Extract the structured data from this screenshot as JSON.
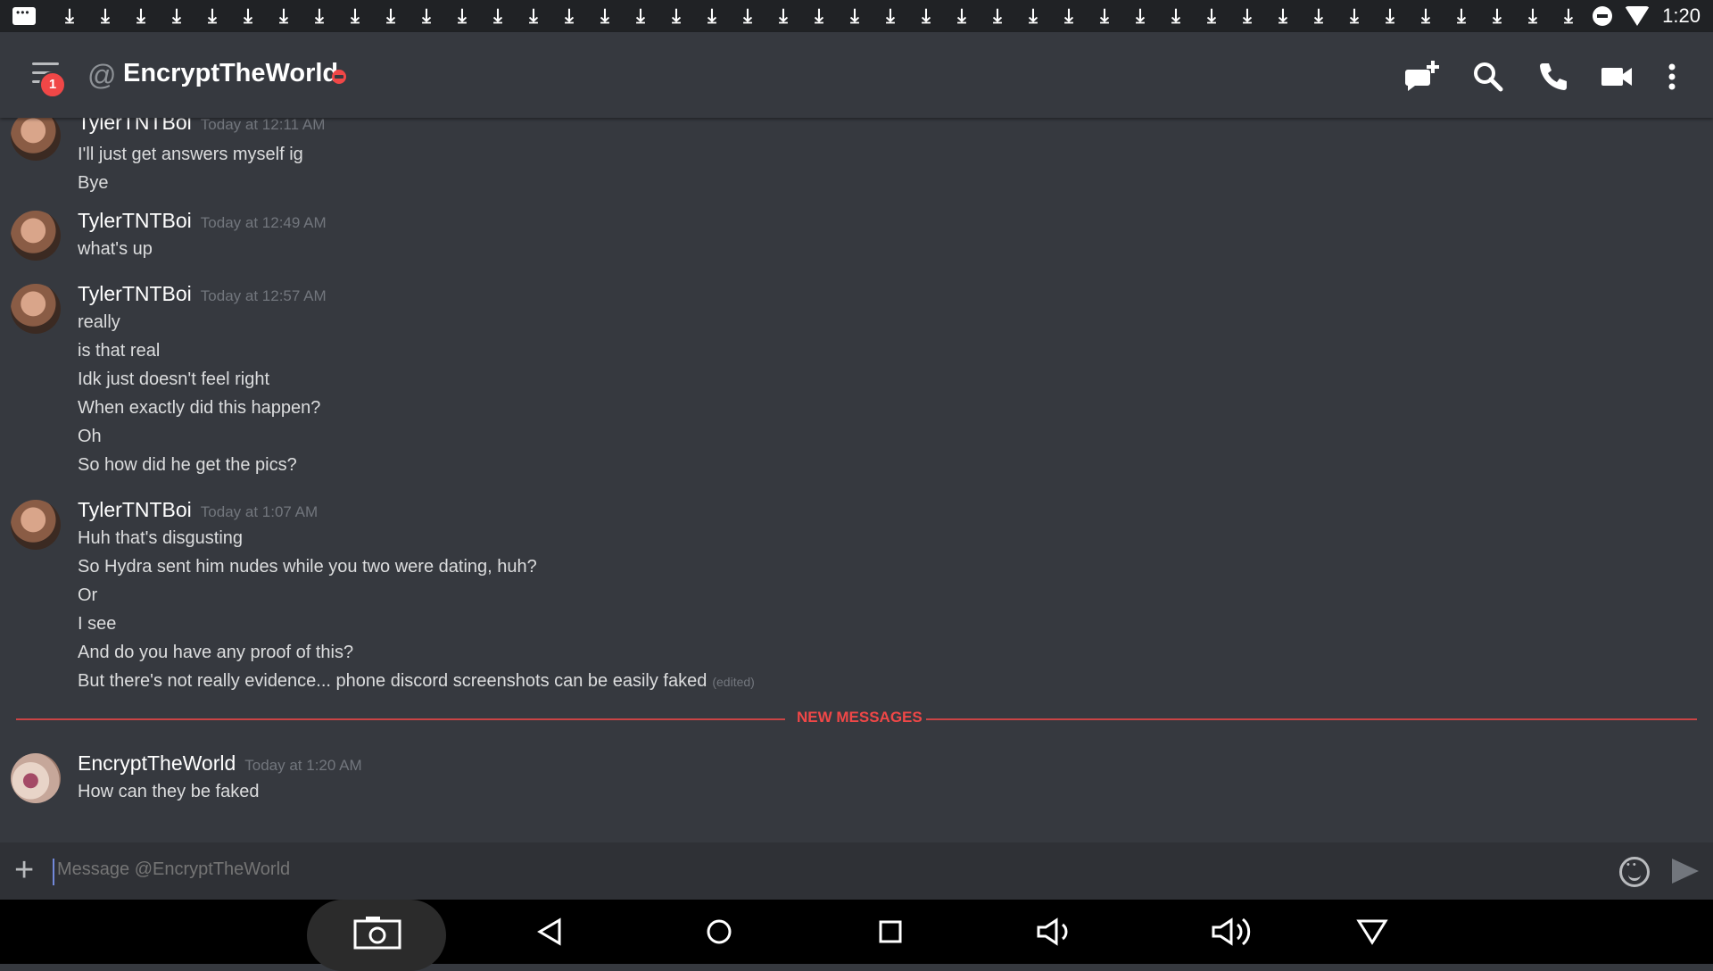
{
  "status_bar": {
    "time": "1:20",
    "download_icon": "download-arrow-icon",
    "download_count": 43
  },
  "header": {
    "title": "EncryptTheWorld",
    "menu_badge": "1",
    "icons": [
      "menu-icon",
      "at-icon",
      "new-group-dm-icon",
      "search-icon",
      "call-icon",
      "video-call-icon",
      "more-vert-icon"
    ],
    "status_color": "#f04747"
  },
  "messages": {
    "groups": [
      {
        "author": "TylerTNTBoi",
        "timestamp": "Today at 12:11 AM",
        "lines": [
          "I'll just get answers myself ig",
          "Bye"
        ]
      },
      {
        "author": "TylerTNTBoi",
        "timestamp": "Today at 12:49 AM",
        "lines": [
          "what's up"
        ]
      },
      {
        "author": "TylerTNTBoi",
        "timestamp": "Today at 12:57 AM",
        "lines": [
          "really",
          "is that real",
          "Idk just doesn't feel right",
          "When exactly did this happen?",
          "Oh",
          "So how did he get the pics?"
        ]
      },
      {
        "author": "TylerTNTBoi",
        "timestamp": "Today at 1:07 AM",
        "lines": [
          "Huh that's disgusting",
          "So Hydra sent him nudes while you two were dating, huh?",
          "Or",
          "I see",
          "And do you have any proof of this?",
          "But there's not really evidence... phone discord screenshots can be easily faked"
        ],
        "edited_label": "(edited)"
      },
      {
        "author": "EncryptTheWorld",
        "timestamp": "Today at 1:20 AM",
        "lines": [
          "How can they be faked"
        ]
      }
    ],
    "new_messages_label": "NEW MESSAGES"
  },
  "input": {
    "placeholder": "Message @EncryptTheWorld",
    "value": ""
  },
  "nav_bar": {
    "buttons": [
      "screenshot-icon",
      "back-icon",
      "home-icon",
      "recents-icon",
      "volume-down-icon",
      "volume-up-icon",
      "notification-shade-icon"
    ]
  },
  "colors": {
    "background": "#36393f",
    "accent_red": "#f04747",
    "text": "#dcddde",
    "muted": "#72767d",
    "input_bg": "#2f3136"
  }
}
